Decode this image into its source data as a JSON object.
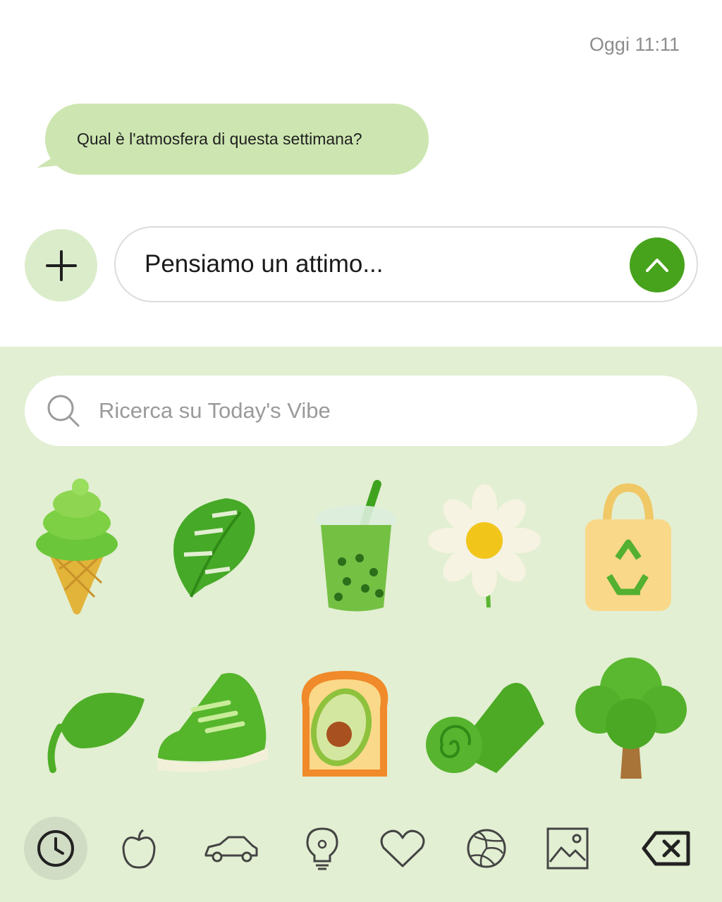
{
  "header": {
    "timestamp": "Oggi 11:11"
  },
  "message": {
    "text": "Qual è l'atmosfera di questa settimana?"
  },
  "composer": {
    "input_value": "Pensiamo un attimo..."
  },
  "emoji_panel": {
    "search_placeholder": "Ricerca su Today's Vibe",
    "stickers": [
      "ice-cream-cone",
      "monstera-leaf",
      "bubble-tea",
      "daisy-flower",
      "recycle-bag",
      "leaf",
      "sneaker",
      "avocado-toast",
      "yoga-mat",
      "tree"
    ],
    "tabs": [
      "recent-clock-icon",
      "apple-icon",
      "car-icon",
      "lightbulb-icon",
      "heart-icon",
      "ball-icon",
      "image-icon",
      "backspace-icon"
    ],
    "active_tab": "recent-clock-icon"
  },
  "colors": {
    "accent": "#48a31c",
    "bubble": "#cde6b1",
    "panel": "#e2efd2"
  }
}
